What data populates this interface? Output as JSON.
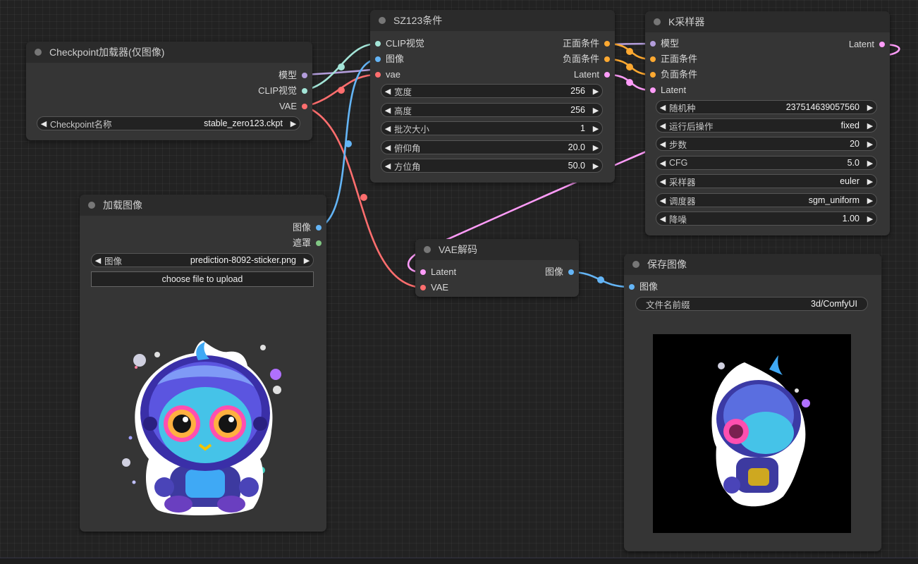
{
  "colors": {
    "model": "#b39ddb",
    "clip": "#a3e4d7",
    "vae": "#ff6e6e",
    "image": "#64b5f6",
    "mask": "#81c784",
    "conditioning": "#ffa931",
    "latent": "#ff9cf9"
  },
  "nodes": {
    "checkpoint": {
      "title": "Checkpoint加载器(仅图像)",
      "outputs": [
        "模型",
        "CLIP视觉",
        "VAE"
      ],
      "widget_label": "Checkpoint名称",
      "widget_value": "stable_zero123.ckpt"
    },
    "load_image": {
      "title": "加载图像",
      "outputs": [
        "图像",
        "遮罩"
      ],
      "widget_label": "图像",
      "widget_value": "prediction-8092-sticker.png",
      "upload_label": "choose file to upload"
    },
    "sz123": {
      "title": "SZ123条件",
      "inputs": [
        "CLIP视觉",
        "图像",
        "vae"
      ],
      "outputs": [
        "正面条件",
        "负面条件",
        "Latent"
      ],
      "widgets": [
        {
          "label": "宽度",
          "value": "256"
        },
        {
          "label": "高度",
          "value": "256"
        },
        {
          "label": "批次大小",
          "value": "1"
        },
        {
          "label": "俯仰角",
          "value": "20.0"
        },
        {
          "label": "方位角",
          "value": "50.0"
        }
      ]
    },
    "ksampler": {
      "title": "K采样器",
      "inputs": [
        "模型",
        "正面条件",
        "负面条件",
        "Latent"
      ],
      "output": "Latent",
      "widgets": [
        {
          "label": "随机种",
          "value": "237514639057560"
        },
        {
          "label": "运行后操作",
          "value": "fixed"
        },
        {
          "label": "步数",
          "value": "20"
        },
        {
          "label": "CFG",
          "value": "5.0"
        },
        {
          "label": "采样器",
          "value": "euler"
        },
        {
          "label": "调度器",
          "value": "sgm_uniform"
        },
        {
          "label": "降噪",
          "value": "1.00"
        }
      ]
    },
    "vae_decode": {
      "title": "VAE解码",
      "inputs": [
        "Latent",
        "VAE"
      ],
      "output": "图像"
    },
    "save_image": {
      "title": "保存图像",
      "input": "图像",
      "widget_label": "文件名前缀",
      "widget_value": "3d/ComfyUI"
    }
  }
}
